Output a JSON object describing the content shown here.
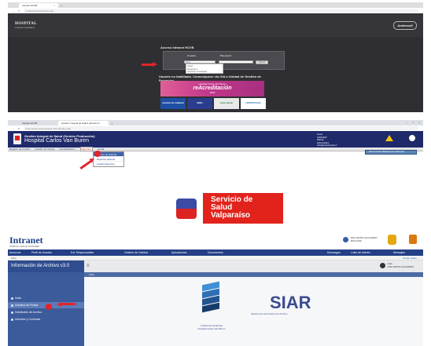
{
  "panel1": {
    "tab": {
      "title": "Intranet HCVB",
      "close": "×",
      "new": "+"
    },
    "address": {
      "url": "localhost/intranet/login.php"
    },
    "header": {
      "logo_main": "HOSPITAL",
      "logo_sub": "CARLOS VAN BUREN",
      "brand": "Andessoft"
    },
    "login": {
      "title": "Acceso Intranet HCVB",
      "user_label": "Usuario",
      "password_label": "Password",
      "user_value": "rsilva",
      "submit": "Ingresar",
      "autofill": [
        "rsilva1",
        "pexample.cl",
        "Gestionar contraseñas"
      ]
    },
    "notice_line1": "Usuario no habilitado. Comuníquese vía OIA a Unidad de Gestión de",
    "notice_line2": "Proyectos.",
    "banner": {
      "line1": "Hospital Carlos Van Buren",
      "line2": "reAcreditación",
      "line3": "2023"
    },
    "tiles": [
      {
        "label": "Gestión de Calidad",
        "bg": "#1f4fa5",
        "fg": "#ffffff"
      },
      {
        "label": "SIRH",
        "bg": "#2a3d8f",
        "fg": "#ffffff"
      },
      {
        "label": "Casa Verde",
        "bg": "#e9e9e9",
        "fg": "#2b7a3a"
      },
      {
        "label": "HOSPITALES",
        "bg": "#ffffff",
        "fg": "#1a6fb3"
      }
    ]
  },
  "panel2": {
    "tabs": [
      "Intranet HCVB",
      "Gestión Integral de Salud (Versión P..."
    ],
    "address": {
      "url": "https://www.espaciosalud.cl/hcvb/index.php"
    },
    "header": {
      "system": "Gestión Integral de Salud (Versión Producción)",
      "hospital": "Hospital Carlos Van Buren",
      "user_lines": [
        "Fecha",
        "01/04/2023",
        "RSILVA",
        "Administrador",
        "rsilva@redsalud.gob.cl"
      ]
    },
    "menu": [
      "Registro de Usuario",
      "Gestión de Camas",
      "Hospitalización",
      "Reportes",
      "Ayuda"
    ],
    "active_menu": "Reportes",
    "dropdown": [
      "Archivo de Historia",
      "Reportes Historia",
      "Listado Reportes"
    ],
    "tooltip": "Nueva Versión Plataforma de Salud (V2)",
    "servicio": {
      "line1": "Servicio de",
      "line2": "Salud",
      "line3": "Valparaíso"
    },
    "colors": {
      "header": "#1f2a6a",
      "accent": "#e1231c"
    }
  },
  "panel3": {
    "logo": "Intranet",
    "logo_sub": "HOSPITAL CARLOS VAN BUREN",
    "user": {
      "name": "DNA ORTIZ GUAJARDO",
      "role": "ROLO190"
    },
    "menu": [
      "Anuncios",
      "Perfil de Usuario",
      "Ext. Responsables",
      "Gestión de Calidad",
      "Aplicaciones",
      "Documentos",
      "Descargas",
      "Links de Interés",
      "Mensajes"
    ],
    "strip": {
      "left": "Inicio",
      "right": "Cerrar sesión"
    },
    "app_title": "Información de Archivo v3.0",
    "burger": "≡",
    "userbox": {
      "line1": "Hola",
      "line2": "DNA ORTIZ GUAJARDO"
    },
    "content_bar": "Inicio",
    "sidebar": [
      "Inicio",
      "Solicitud de Fichas",
      "Solicitudes de Archivo",
      "Informes y Controles"
    ],
    "siar": {
      "title": "SIAR",
      "subtitle": "Sistema de Información de Archivo",
      "footer1": "Unidad de Desarrollo",
      "footer2": "Hospital Carlos Van Buren"
    }
  }
}
